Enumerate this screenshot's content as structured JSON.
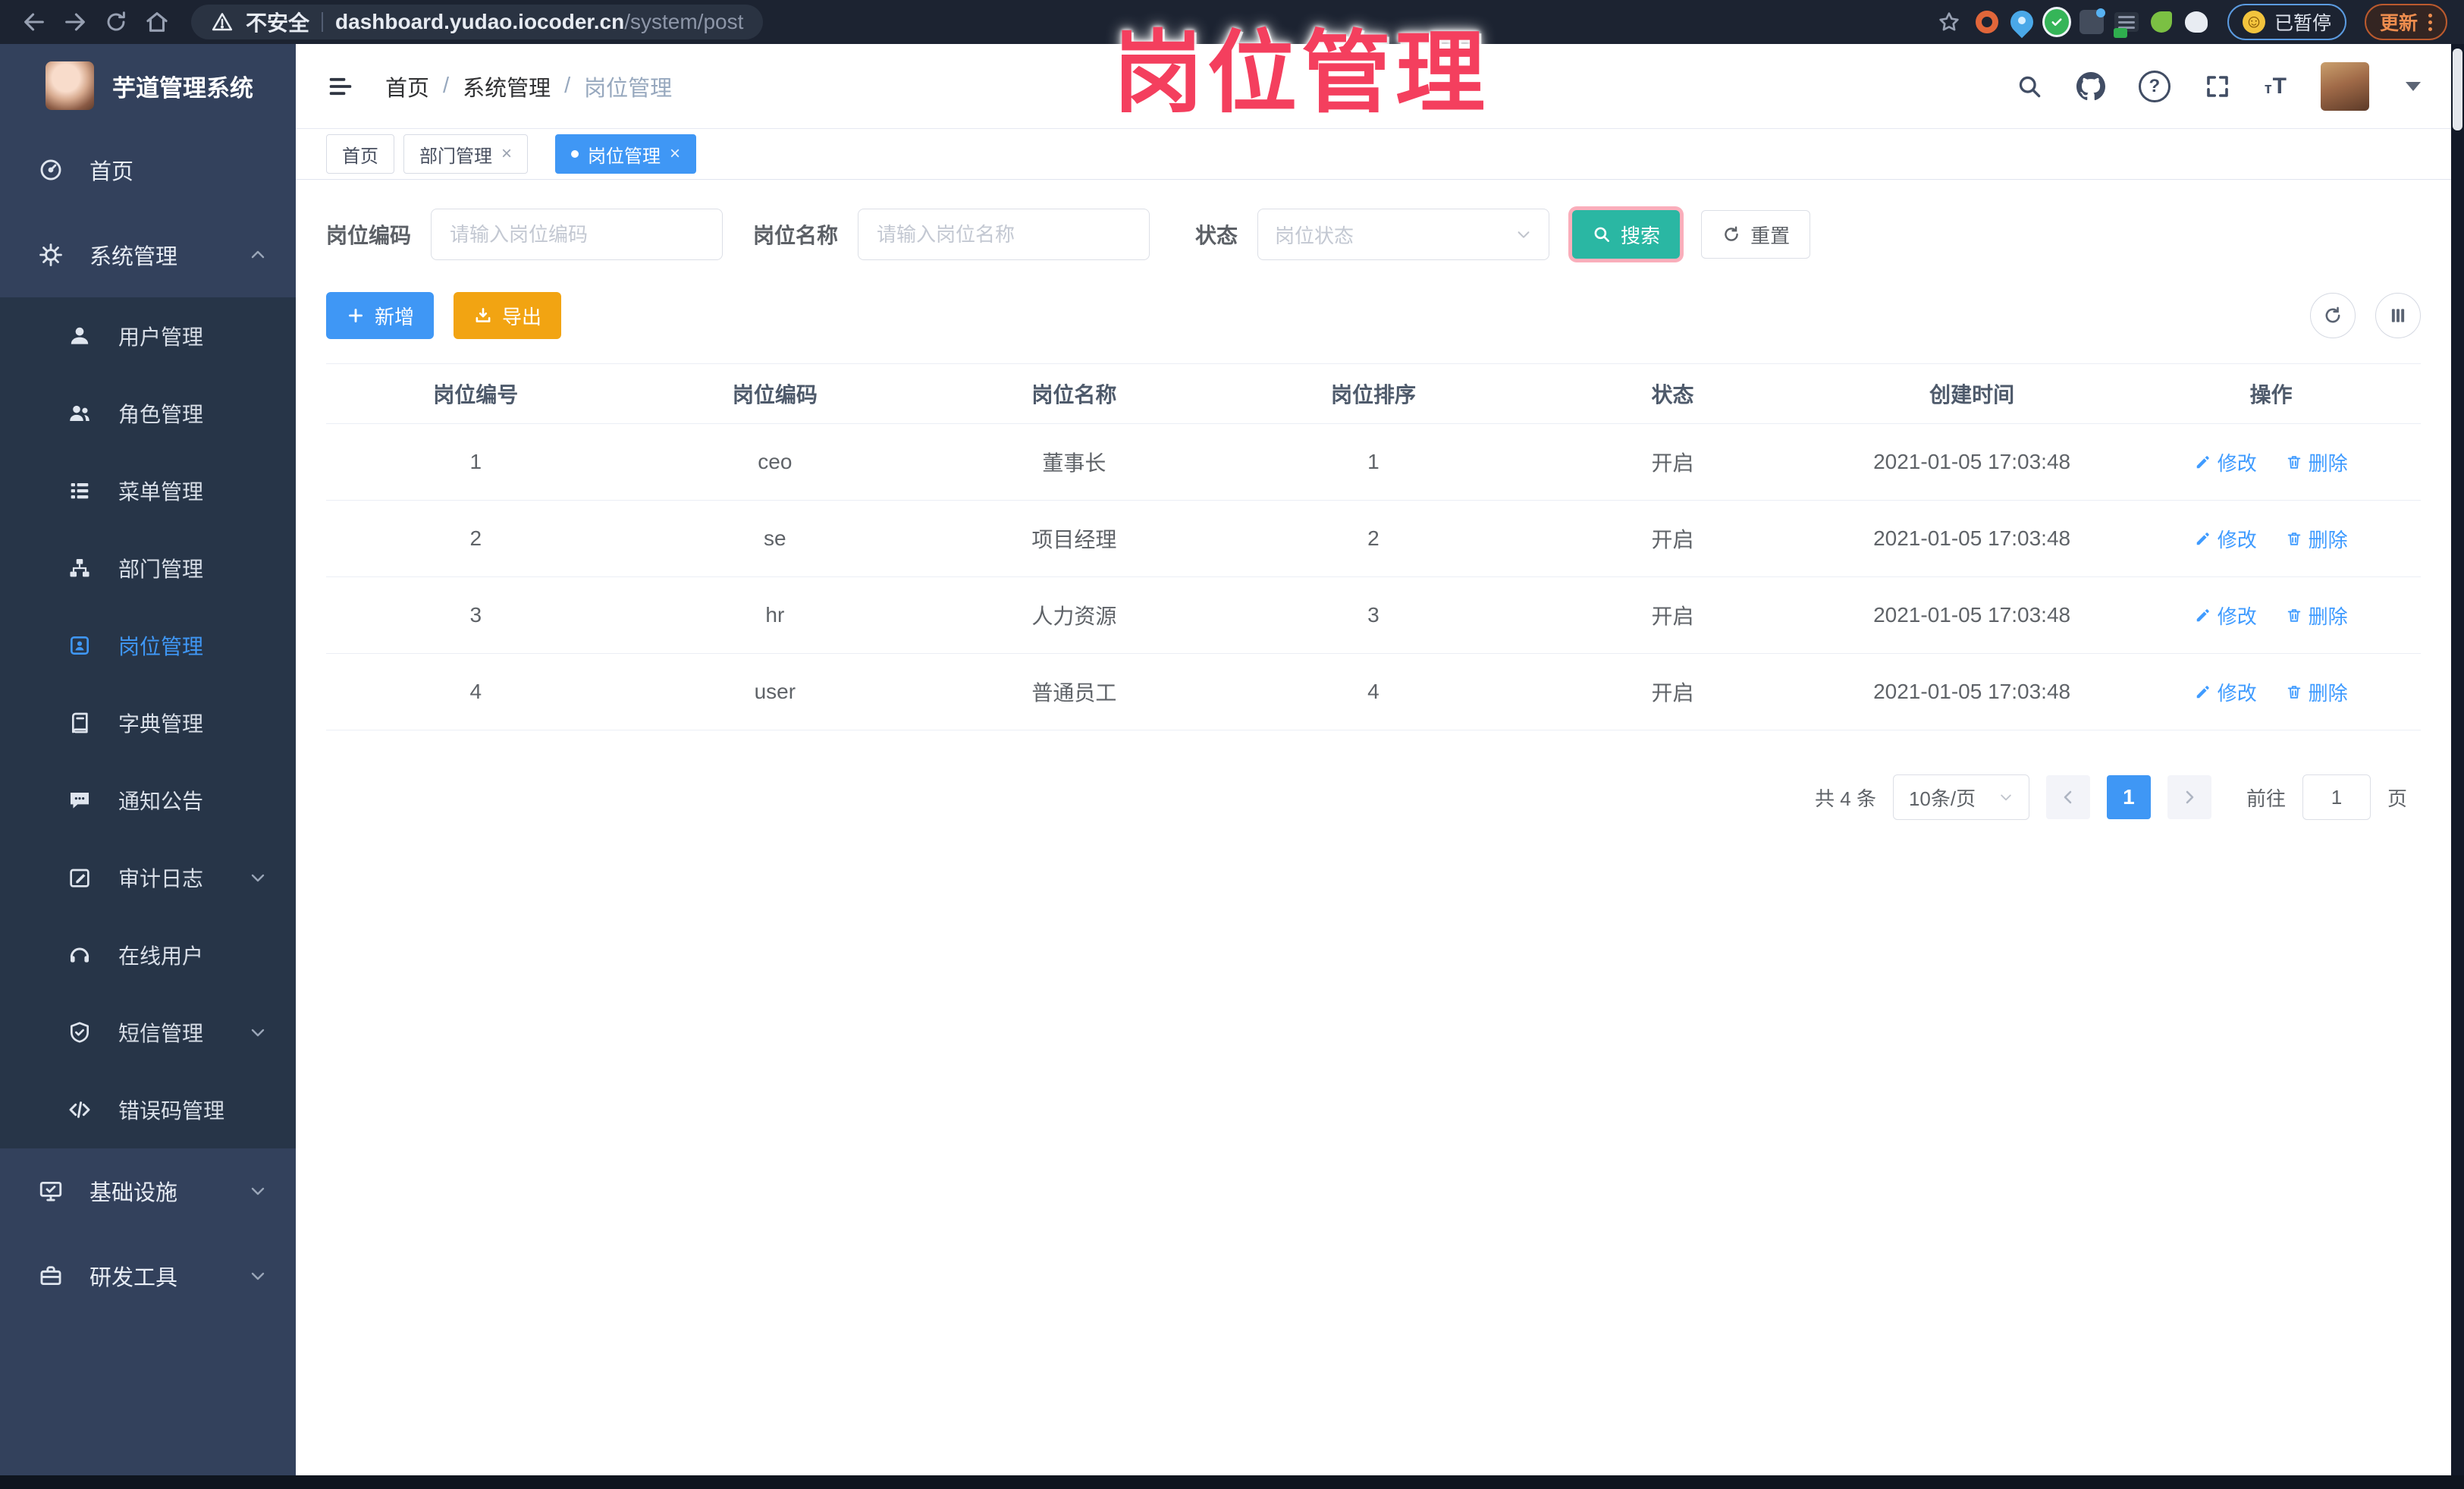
{
  "browser": {
    "security_label": "不安全",
    "url_domain": "dashboard.yudao.iocoder.cn",
    "url_path": "/system/post",
    "paused_label": "已暂停",
    "update_label": "更新"
  },
  "annotation": {
    "title": "岗位管理",
    "color": "#f43f5e"
  },
  "sidebar": {
    "app_title": "芋道管理系统",
    "items": [
      {
        "label": "首页"
      },
      {
        "label": "系统管理"
      },
      {
        "label": "用户管理"
      },
      {
        "label": "角色管理"
      },
      {
        "label": "菜单管理"
      },
      {
        "label": "部门管理"
      },
      {
        "label": "岗位管理",
        "active": true
      },
      {
        "label": "字典管理"
      },
      {
        "label": "通知公告"
      },
      {
        "label": "审计日志"
      },
      {
        "label": "在线用户"
      },
      {
        "label": "短信管理"
      },
      {
        "label": "错误码管理"
      },
      {
        "label": "基础设施"
      },
      {
        "label": "研发工具"
      }
    ]
  },
  "header": {
    "breadcrumb": [
      "首页",
      "系统管理",
      "岗位管理"
    ]
  },
  "tabs": [
    {
      "label": "首页"
    },
    {
      "label": "部门管理"
    },
    {
      "label": "岗位管理",
      "active": true
    }
  ],
  "filters": {
    "code_label": "岗位编码",
    "code_placeholder": "请输入岗位编码",
    "name_label": "岗位名称",
    "name_placeholder": "请输入岗位名称",
    "status_label": "状态",
    "status_placeholder": "岗位状态",
    "search_label": "搜索",
    "reset_label": "重置"
  },
  "toolbar": {
    "add_label": "新增",
    "export_label": "导出"
  },
  "table": {
    "columns": [
      "岗位编号",
      "岗位编码",
      "岗位名称",
      "岗位排序",
      "状态",
      "创建时间",
      "操作"
    ],
    "edit_label": "修改",
    "delete_label": "删除",
    "rows": [
      {
        "id": "1",
        "code": "ceo",
        "name": "董事长",
        "sort": "1",
        "status": "开启",
        "created": "2021-01-05 17:03:48"
      },
      {
        "id": "2",
        "code": "se",
        "name": "项目经理",
        "sort": "2",
        "status": "开启",
        "created": "2021-01-05 17:03:48"
      },
      {
        "id": "3",
        "code": "hr",
        "name": "人力资源",
        "sort": "3",
        "status": "开启",
        "created": "2021-01-05 17:03:48"
      },
      {
        "id": "4",
        "code": "user",
        "name": "普通员工",
        "sort": "4",
        "status": "开启",
        "created": "2021-01-05 17:03:48"
      }
    ]
  },
  "pagination": {
    "total": "共 4 条",
    "page_size": "10条/页",
    "prev": "‹",
    "next": "›",
    "current_page": "1",
    "goto_prefix": "前往",
    "goto_value": "1",
    "goto_suffix": "页"
  },
  "colors": {
    "accent_blue": "#409eff",
    "search_teal": "#2ab7a3",
    "export_orange": "#f2a412",
    "annotation_pink": "#f43f5e",
    "sidebar_bg": "#33415c",
    "submenu_bg": "#273548",
    "browser_bar_bg": "#1c2331"
  }
}
